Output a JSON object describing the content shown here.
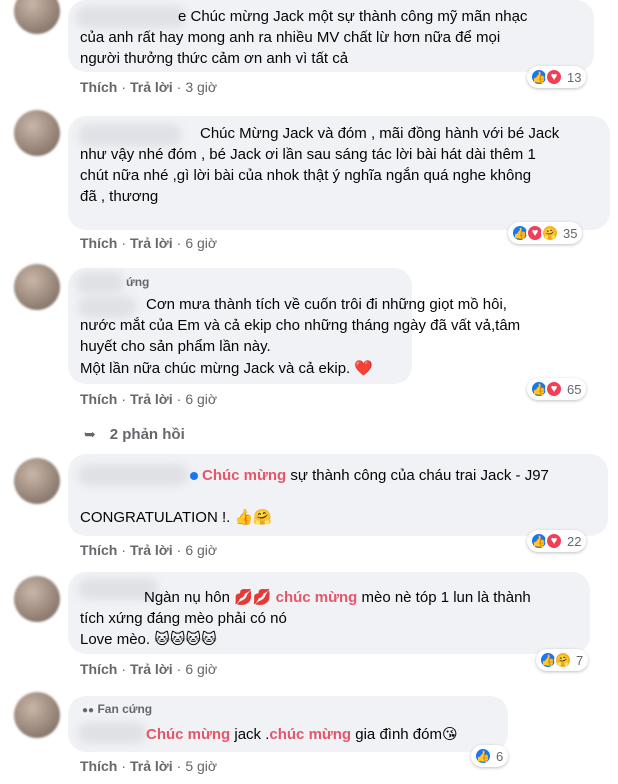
{
  "comments": [
    {
      "lines": [
        "e Chúc mừng Jack một sự thành công mỹ mãn nhạc",
        "của anh rất hay mong anh ra nhiều MV chất lừ hơn nữa để mọi",
        "người thưởng thức cảm ơn anh vì tất cả"
      ],
      "actions": {
        "like": "Thích",
        "reply": "Trả lời",
        "sep": "·",
        "time": "3 giờ"
      },
      "reactions": {
        "icons": [
          "like-icon",
          "love-icon"
        ],
        "count": "13"
      }
    },
    {
      "lines": [
        "Chúc Mừng Jack và đóm , mãi đồng hành với bé Jack",
        "như vậy nhé đóm , bé Jack ơi lần sau sáng tác lời bài hát dài thêm 1",
        "chút nữa nhé ,gì lời bài của nhok thật ý nghĩa ngắn quá nghe không",
        "đã , thương"
      ],
      "actions": {
        "like": "Thích",
        "reply": "Trả lời",
        "sep": "·",
        "time": "6 giờ"
      },
      "reactions": {
        "icons": [
          "like-icon",
          "love-icon",
          "care-icon"
        ],
        "count": "35"
      }
    },
    {
      "name": "ứng",
      "lines": [
        "Cơn mưa thành tích về cuốn trôi đi những giọt mồ hôi,",
        "nước mắt của Em và cả ekip cho những tháng ngày đã vất vả,tâm",
        "huyết cho sản phẩm lần này.",
        "Một lần nữa chúc mừng Jack và cả ekip."
      ],
      "line4_emoji": "❤️",
      "actions": {
        "like": "Thích",
        "reply": "Trả lời",
        "sep": "·",
        "time": "6 giờ"
      },
      "reactions": {
        "icons": [
          "like-icon",
          "love-icon"
        ],
        "count": "65"
      },
      "replies": "2 phản hồi"
    },
    {
      "line1_highlight": "Chúc mừng",
      "line1_rest": " sự thành công của cháu trai Jack - J97",
      "line2": "CONGRATULATION !.",
      "line2_emoji": "👍🤗",
      "actions": {
        "like": "Thích",
        "reply": "Trả lời",
        "sep": "·",
        "time": "6 giờ"
      },
      "reactions": {
        "icons": [
          "like-icon",
          "love-icon"
        ],
        "count": "22"
      }
    },
    {
      "line1_pre": "Ngàn nụ hôn ",
      "line1_emoji": "💋💋",
      "line1_highlight": "chúc mừng",
      "line1_rest": " mèo nè tóp 1 lun là thành",
      "line2": "tích xứng đáng mèo phải có nó",
      "line3": "Love mèo.",
      "line3_emoji": "🐱🐱🐱🐱",
      "actions": {
        "like": "Thích",
        "reply": "Trả lời",
        "sep": "·",
        "time": "6 giờ"
      },
      "reactions": {
        "icons": [
          "like-icon",
          "care-icon"
        ],
        "count": "7"
      }
    },
    {
      "name": "Fan cứng",
      "hl1": "Chúc mừng",
      "mid": " jack .",
      "hl2": "chúc mừng",
      "rest": " gia đình đóm",
      "emoji": "😘",
      "actions": {
        "like": "Thích",
        "reply": "Trả lời",
        "sep": "·",
        "time": "5 giờ"
      },
      "reactions": {
        "icons": [
          "like-icon"
        ],
        "count": "6"
      }
    }
  ],
  "colors": {
    "like": "#1877f2",
    "love": "#f33e58",
    "care": "#f7b125",
    "highlight": "#e4576a",
    "bubble": "#f0f2f5",
    "meta": "#65676b"
  }
}
